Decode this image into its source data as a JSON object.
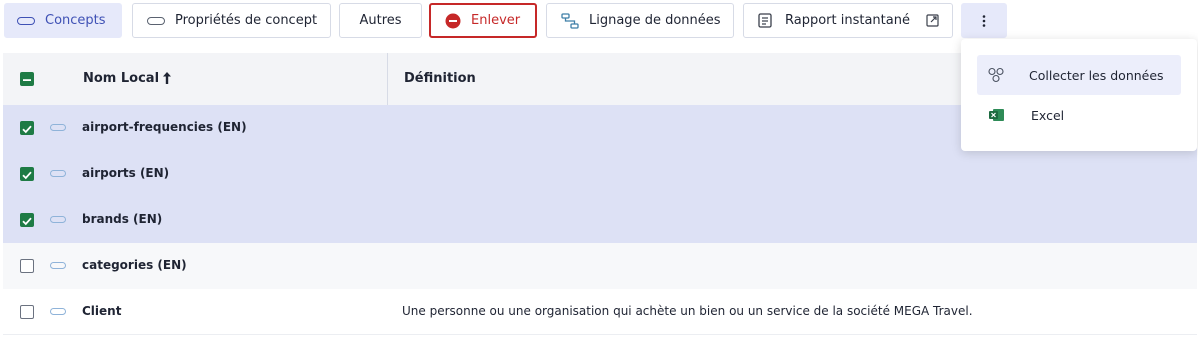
{
  "toolbar": {
    "concepts_label": "Concepts",
    "properties_label": "Propriétés de concept",
    "others_label": "Autres",
    "remove_label": "Enlever",
    "lineage_label": "Lignage de données",
    "report_label": "Rapport instantané"
  },
  "table": {
    "columns": [
      "Nom Local",
      "Définition"
    ],
    "sort": "ascending",
    "rows": [
      {
        "name": "airport-frequencies (EN)",
        "definition": "",
        "checked": true
      },
      {
        "name": "airports (EN)",
        "definition": "",
        "checked": true
      },
      {
        "name": "brands (EN)",
        "definition": "",
        "checked": true
      },
      {
        "name": "categories (EN)",
        "definition": "",
        "checked": false
      },
      {
        "name": "Client",
        "definition": "Une personne ou une organisation qui achète un bien ou un service de la société MEGA Travel.",
        "checked": false
      }
    ]
  },
  "menu": {
    "items": [
      {
        "label": "Collecter les données",
        "icon": "collect-data-icon"
      },
      {
        "label": "Excel",
        "icon": "excel-icon"
      }
    ]
  },
  "colors": {
    "accent": "#3f51b5",
    "danger": "#c62828",
    "check": "#1e7b45",
    "selected_row": "#dde1f5"
  }
}
